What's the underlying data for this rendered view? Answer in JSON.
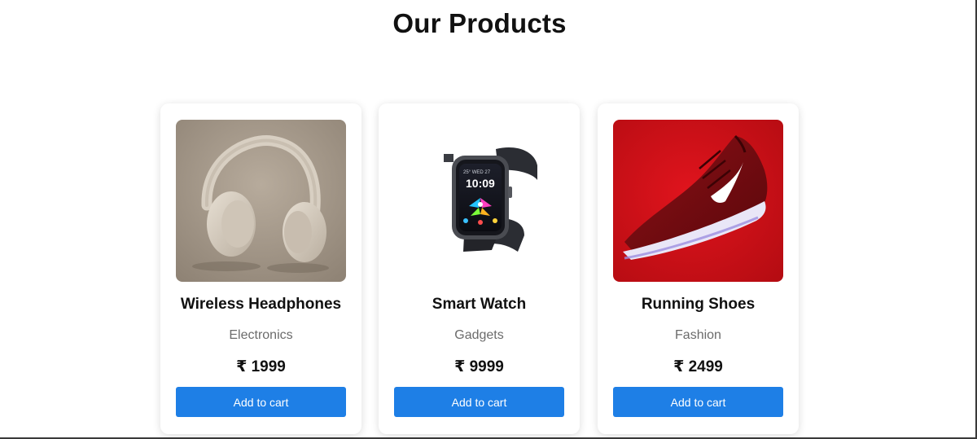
{
  "page": {
    "title": "Our Products"
  },
  "colors": {
    "button": "#1e7fe6",
    "category_text": "#6b6b6b"
  },
  "products": [
    {
      "name": "Wireless Headphones",
      "category": "Electronics",
      "price": "₹ 1999",
      "button_label": "Add to cart",
      "image": "headphones-image"
    },
    {
      "name": "Smart Watch",
      "category": "Gadgets",
      "price": "₹ 9999",
      "button_label": "Add to cart",
      "image": "smartwatch-image",
      "watch_screen": {
        "time": "10:09",
        "status": "25° WED 27"
      }
    },
    {
      "name": "Running Shoes",
      "category": "Fashion",
      "price": "₹ 2499",
      "button_label": "Add to cart",
      "image": "running-shoe-image"
    }
  ]
}
